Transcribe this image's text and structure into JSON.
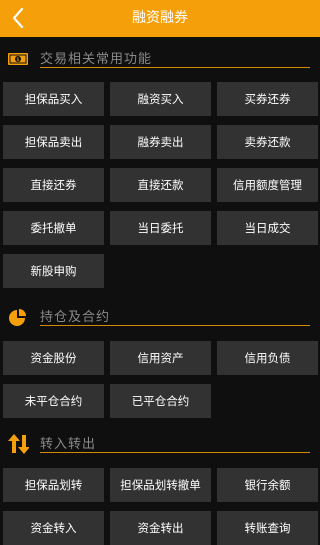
{
  "header": {
    "title": "融资融券",
    "accent_color": "#f5a00b"
  },
  "sections": [
    {
      "title": "交易相关常用功能",
      "icon": "money-bill-icon",
      "buttons": [
        "担保品买入",
        "融资买入",
        "买券还券",
        "担保品卖出",
        "融券卖出",
        "卖券还款",
        "直接还券",
        "直接还款",
        "信用额度管理",
        "委托撤单",
        "当日委托",
        "当日成交",
        "新股申购"
      ]
    },
    {
      "title": "持仓及合约",
      "icon": "pie-chart-icon",
      "buttons": [
        "资金股份",
        "信用资产",
        "信用负债",
        "未平仓合约",
        "已平仓合约"
      ]
    },
    {
      "title": "转入转出",
      "icon": "transfer-arrows-icon",
      "buttons": [
        "担保品划转",
        "担保品划转撤单",
        "银行余额",
        "资金转入",
        "资金转出",
        "转账查询"
      ]
    }
  ]
}
